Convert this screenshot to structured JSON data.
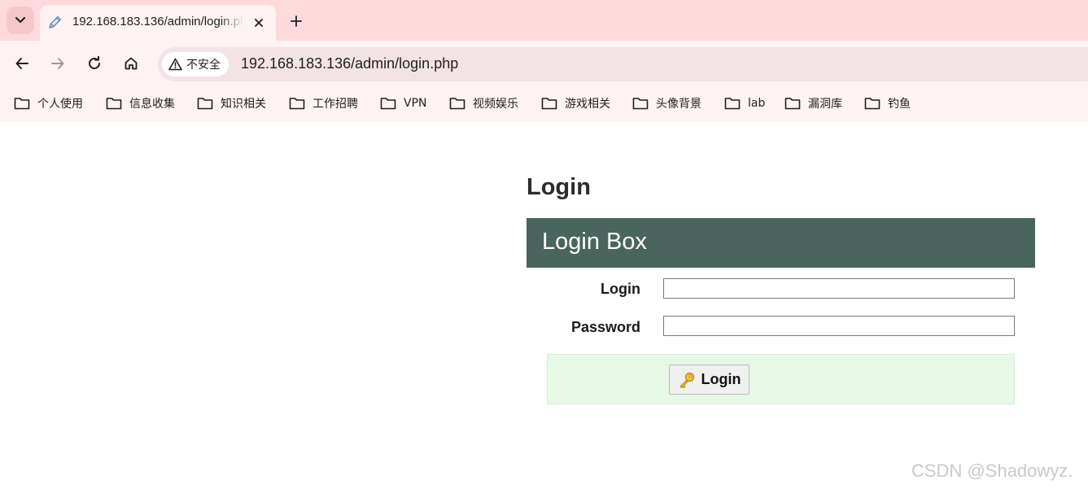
{
  "browser": {
    "tab": {
      "title": "192.168.183.136/admin/login.php",
      "favicon": "pencil-icon"
    },
    "address_bar": {
      "security_label": "不安全",
      "url": "192.168.183.136/admin/login.php"
    },
    "bookmarks": [
      {
        "label": "个人使用",
        "icon": "folder-icon"
      },
      {
        "label": "信息收集",
        "icon": "folder-icon"
      },
      {
        "label": "知识相关",
        "icon": "folder-icon"
      },
      {
        "label": "工作招聘",
        "icon": "folder-icon"
      },
      {
        "label": "VPN",
        "icon": "folder-icon"
      },
      {
        "label": "视频娱乐",
        "icon": "folder-icon"
      },
      {
        "label": "游戏相关",
        "icon": "folder-icon"
      },
      {
        "label": "头像背景",
        "icon": "folder-icon"
      },
      {
        "label": "lab",
        "icon": "folder-icon"
      },
      {
        "label": "漏洞库",
        "icon": "folder-icon"
      },
      {
        "label": "钓鱼",
        "icon": "folder-icon"
      }
    ],
    "colors": {
      "tabstrip": "#fedadc",
      "toolbar": "#fff2f2",
      "omnibox": "#f2e4e6"
    }
  },
  "page": {
    "heading": "Login",
    "login_box": {
      "title": "Login Box",
      "fields": [
        {
          "label": "Login",
          "value": ""
        },
        {
          "label": "Password",
          "value": ""
        }
      ],
      "submit_label": "Login",
      "submit_icon": "key-icon"
    },
    "colors": {
      "box_header": "#4a655d",
      "actions_panel": "#e8f8e6"
    }
  },
  "watermark": "CSDN @Shadowyz."
}
